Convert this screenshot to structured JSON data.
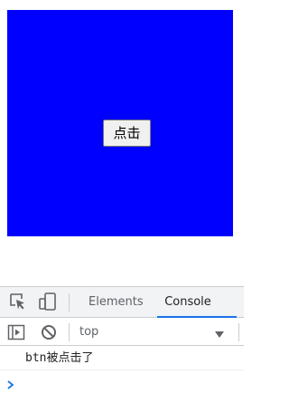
{
  "page": {
    "button_label": "点击"
  },
  "devtools": {
    "tabs": [
      {
        "label": "Elements"
      },
      {
        "label": "Console"
      }
    ],
    "active_tab": "Console",
    "context": "top",
    "console_messages": [
      {
        "text": "btn被点击了"
      }
    ],
    "icons": {
      "inspect": "inspect-element-icon",
      "device": "device-toggle-icon",
      "sidebar": "console-sidebar-icon",
      "clear": "clear-console-icon",
      "dropdown": "chevron-down-icon",
      "prompt": "prompt-chevron-icon"
    },
    "colors": {
      "box": "#0000ff",
      "accent": "#1a73e8"
    }
  }
}
